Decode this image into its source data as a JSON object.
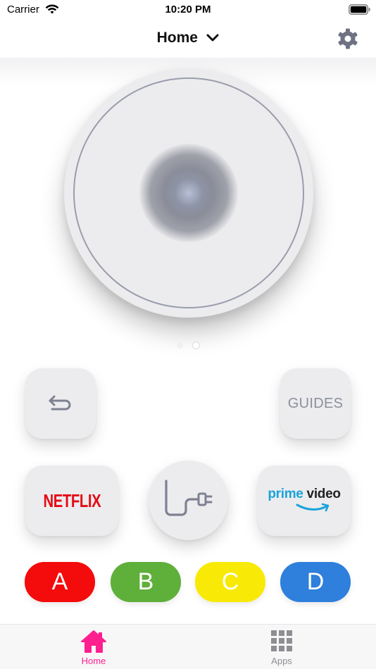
{
  "status_bar": {
    "carrier": "Carrier",
    "time": "10:20 PM"
  },
  "header": {
    "title": "Home",
    "title_icon": "chevron-down-icon",
    "settings_icon": "gear-icon"
  },
  "touchpad": {
    "pages": 2,
    "active_page": 2
  },
  "buttons": {
    "back_icon": "return-arrow-icon",
    "guides_label": "GUIDES",
    "netflix_label": "NETFLIX",
    "input_icon": "cable-plug-icon",
    "prime_word": "prime",
    "prime_rest": "video"
  },
  "color_buttons": {
    "a": "A",
    "b": "B",
    "c": "C",
    "d": "D"
  },
  "colors": {
    "accent": "#ff1f8f",
    "netflix_red": "#e50914",
    "prime_blue": "#1aa3da",
    "button_a": "#f40b0b",
    "button_b": "#5faf3b",
    "button_c": "#f8ea06",
    "button_d": "#2f7fdc",
    "inactive_tab": "#8e8e93"
  },
  "tab_bar": {
    "home_label": "Home",
    "apps_label": "Apps",
    "active_tab": "Home"
  }
}
